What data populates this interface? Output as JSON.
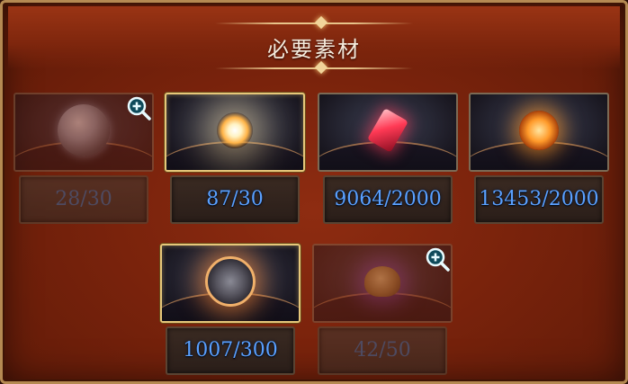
{
  "panel": {
    "title": "必要素材"
  },
  "materials": [
    {
      "count": "28/30",
      "art": "orb-relic",
      "enough": false,
      "zoom_icon": "magnifier-plus-icon"
    },
    {
      "count": "87/30",
      "art": "star-burst",
      "enough": true
    },
    {
      "count": "9064/2000",
      "art": "red-crystal",
      "enough": true
    },
    {
      "count": "13453/2000",
      "art": "amber-sigil",
      "enough": true
    },
    {
      "count": "1007/300",
      "art": "ringed-core",
      "enough": true
    },
    {
      "count": "42/50",
      "art": "void-shell",
      "enough": false,
      "zoom_icon": "magnifier-plus-icon"
    }
  ],
  "colors": {
    "count_text": "#5aa0ff",
    "count_text_dim": "#3e5c84",
    "gold_frame": "#e6c77a",
    "panel_bg": "#7a230c"
  }
}
